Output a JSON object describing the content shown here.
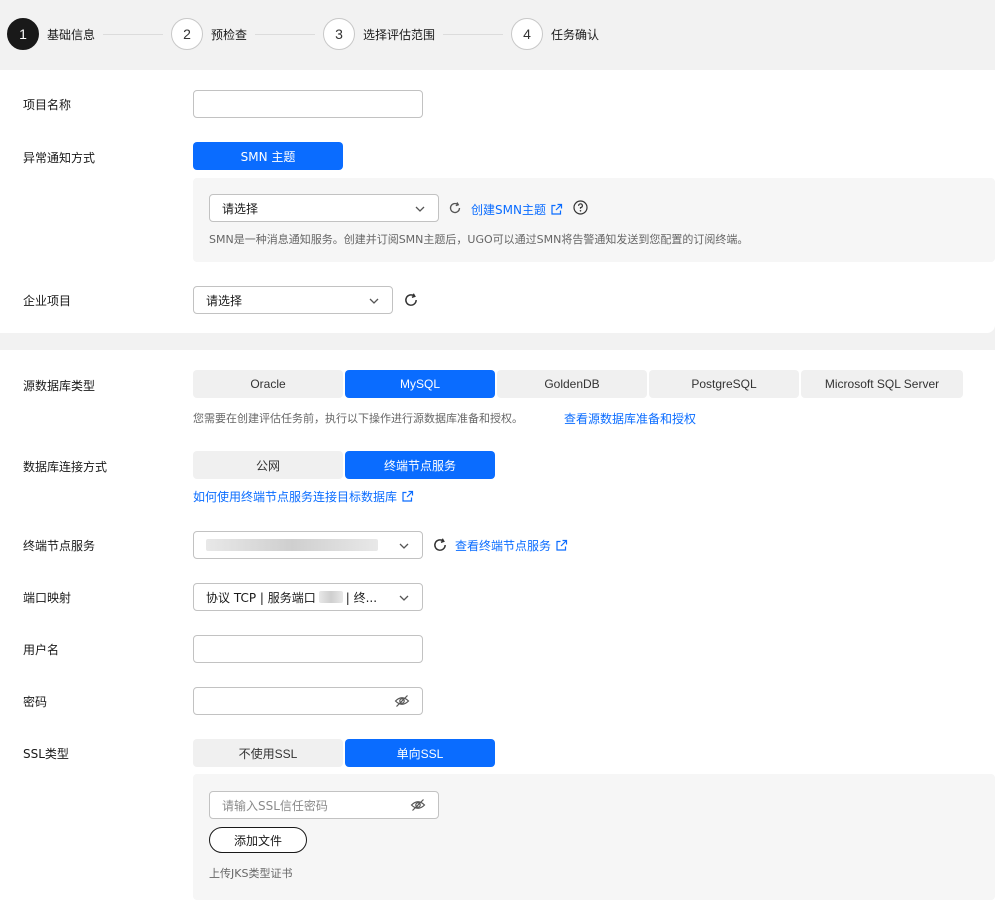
{
  "steps": [
    {
      "num": "1",
      "label": "基础信息"
    },
    {
      "num": "2",
      "label": "预检查"
    },
    {
      "num": "3",
      "label": "选择评估范围"
    },
    {
      "num": "4",
      "label": "任务确认"
    }
  ],
  "form1": {
    "project_name_label": "项目名称",
    "project_name_value": "",
    "notify_label": "异常通知方式",
    "notify_button": "SMN 主题",
    "smn_select_placeholder": "请选择",
    "create_smn_link": "创建SMN主题",
    "smn_hint": "SMN是一种消息通知服务。创建并订阅SMN主题后，UGO可以通过SMN将告警通知发送到您配置的订阅终端。",
    "enterprise_label": "企业项目",
    "enterprise_placeholder": "请选择"
  },
  "form2": {
    "source_db_label": "源数据库类型",
    "db_types": [
      "Oracle",
      "MySQL",
      "GoldenDB",
      "PostgreSQL",
      "Microsoft SQL Server"
    ],
    "db_types_selected": "MySQL",
    "db_hint": "您需要在创建评估任务前，执行以下操作进行源数据库准备和授权。",
    "db_hint_link": "查看源数据库准备和授权",
    "conn_label": "数据库连接方式",
    "conn_types": [
      "公网",
      "终端节点服务"
    ],
    "conn_selected": "终端节点服务",
    "conn_link": "如何使用终端节点服务连接目标数据库",
    "endpoint_label": "终端节点服务",
    "endpoint_link": "查看终端节点服务",
    "port_label": "端口映射",
    "port_value_prefix": "协议 TCP | 服务端口",
    "port_value_suffix": "| 终...",
    "username_label": "用户名",
    "username_value": "",
    "password_label": "密码",
    "password_value": "",
    "ssl_label": "SSL类型",
    "ssl_types": [
      "不使用SSL",
      "单向SSL"
    ],
    "ssl_selected": "单向SSL",
    "ssl_password_placeholder": "请输入SSL信任密码",
    "add_file_button": "添加文件",
    "upload_hint": "上传JKS类型证书"
  },
  "colors": {
    "primary": "#0a6cff",
    "active_step": "#191919",
    "segment_bg": "#f0f0f0",
    "page_bg": "#f2f2f2"
  },
  "icons": {
    "refresh": "refresh-icon",
    "external": "external-link-icon",
    "help": "question-circle-icon",
    "eye_off": "eye-off-icon",
    "chevron": "chevron-down-icon"
  }
}
